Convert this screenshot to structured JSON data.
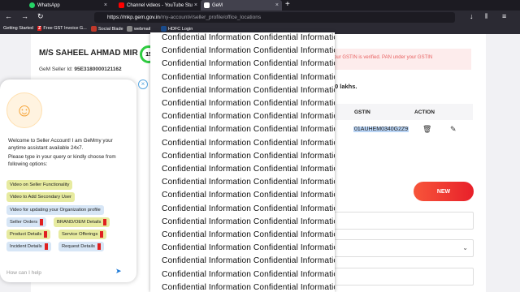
{
  "browser": {
    "tabs": [
      {
        "label": "WhatsApp",
        "fav_color": "#25d366"
      },
      {
        "label": "Channel videos - YouTube Stu",
        "fav_color": "#ff0000"
      },
      {
        "label": "GeM",
        "fav_color": "#ffffff"
      }
    ],
    "url": {
      "host": "https://mkp.gem.gov.in",
      "path": "/my-account#/seller_profile/office_locations"
    },
    "bookmarks": [
      {
        "label": "Getting Started"
      },
      {
        "label": "Free GST Invoice G..."
      },
      {
        "label": "Social Blade"
      },
      {
        "label": "webmail"
      },
      {
        "label": "HDFC Login"
      }
    ]
  },
  "seller": {
    "name": "M/S SAHEEL AHMAD MIR",
    "id_label": "GeM Seller Id:",
    "id_value": "95E3180000121162",
    "score": "15"
  },
  "alert_text": "your GSTIN is verified. PAN under your GSTIN",
  "limit_text": "0 lakhs.",
  "table": {
    "headers": [
      "GSTIN",
      "ACTION"
    ],
    "row_gstin": "01AUHEM0340G2Z9"
  },
  "new_button": "NEW",
  "chat": {
    "greeting": "Welcome to Seller Account! I am GeMmy your anytime assistant available 24x7.",
    "prompt": "Please type in your query or kindly choose from following options:",
    "options": [
      {
        "label": "Video on Seller Functionality",
        "color": "yellow"
      },
      {
        "label": "Video to Add Secondary User",
        "color": "yellow"
      },
      {
        "label": "Video for updating your Organization profile",
        "color": "blue"
      },
      {
        "label": "Seller Orders",
        "color": "blue"
      },
      {
        "label": "BRAND/OEM Details",
        "color": "yellow"
      },
      {
        "label": "Product Details",
        "color": "yellow"
      },
      {
        "label": "Service Offerings",
        "color": "yellow"
      },
      {
        "label": "Incident Details",
        "color": "blue"
      },
      {
        "label": "Request Details",
        "color": "blue"
      }
    ],
    "input_placeholder": "How can I help"
  },
  "overlay": {
    "text": "Confidential  Information  Confidential  Information"
  }
}
